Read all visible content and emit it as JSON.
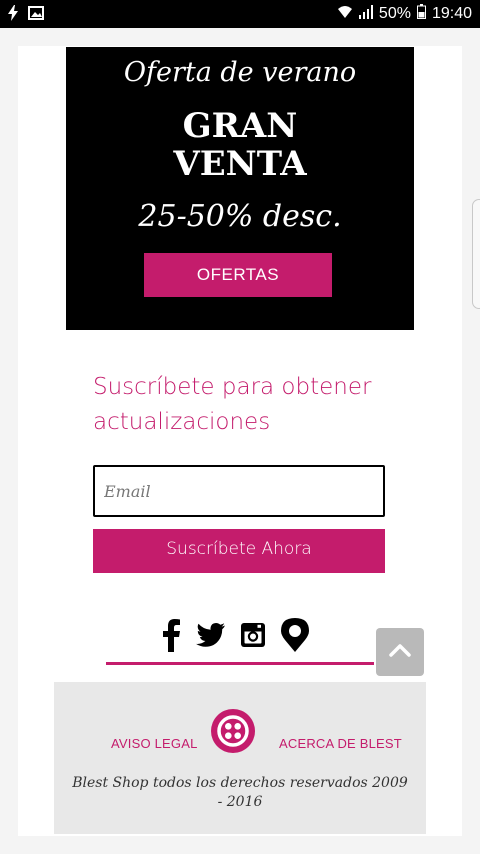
{
  "status_bar": {
    "battery": "50%",
    "time": "19:40",
    "left_icons": [
      "flash-icon",
      "image-icon"
    ],
    "right_icons": [
      "wifi-icon",
      "signal-icon",
      "battery-icon"
    ]
  },
  "banner": {
    "kicker": "Oferta de verano",
    "headline": "GRAN\nVENTA",
    "discount": "25-50% desc.",
    "button_label": "OFERTAS"
  },
  "subscribe": {
    "title": "Suscríbete para obtener actualizaciones",
    "email_placeholder": "Email",
    "button_label": "Suscríbete Ahora"
  },
  "social": {
    "icons": [
      "facebook-icon",
      "twitter-icon",
      "instagram-icon",
      "location-pin-icon"
    ]
  },
  "footer": {
    "legal_link": "AVISO LEGAL",
    "about_link": "ACERCA DE BLEST",
    "copyright": "Blest Shop todos los derechos reservados 2009 - 2016"
  },
  "colors": {
    "accent": "#c41c6c",
    "banner_bg": "#000000",
    "footer_bg": "#e8e8e8"
  }
}
